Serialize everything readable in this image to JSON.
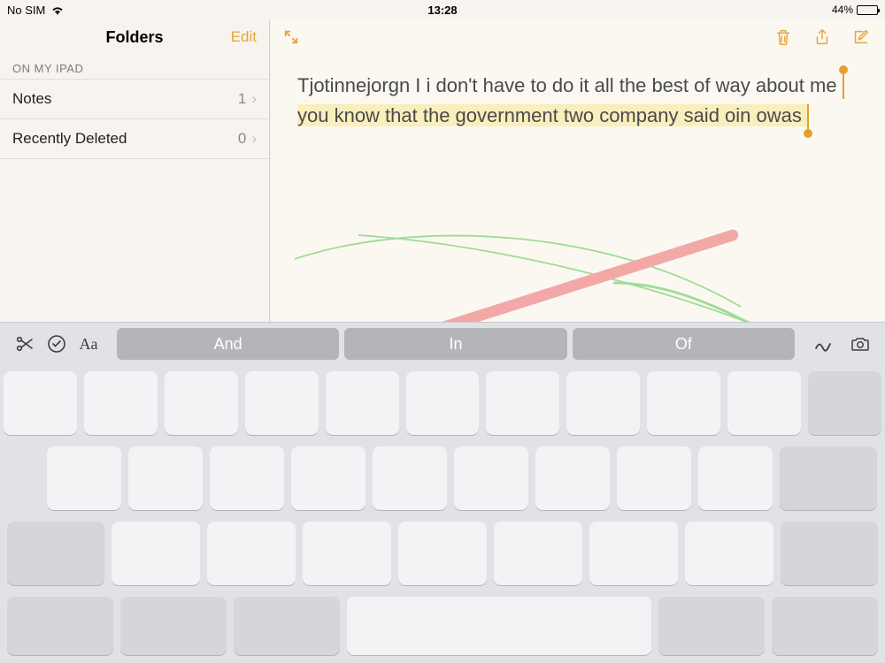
{
  "status": {
    "carrier": "No SIM",
    "time": "13:28",
    "battery_pct": "44%"
  },
  "sidebar": {
    "title": "Folders",
    "edit_label": "Edit",
    "section_label": "ON MY IPAD",
    "items": [
      {
        "label": "Notes",
        "count": "1"
      },
      {
        "label": "Recently Deleted",
        "count": "0"
      }
    ]
  },
  "note": {
    "text_pre": "Tjotinnejorgn I i don't have to do it all the best of way about me ",
    "text_sel": "you know that the government two company said oin owas ",
    "highlight_color": "#f9eebc",
    "handle_color": "#e3a02a"
  },
  "keyboard": {
    "suggestions": [
      "And",
      "In",
      "Of"
    ]
  },
  "colors": {
    "accent": "#e8a33c"
  }
}
